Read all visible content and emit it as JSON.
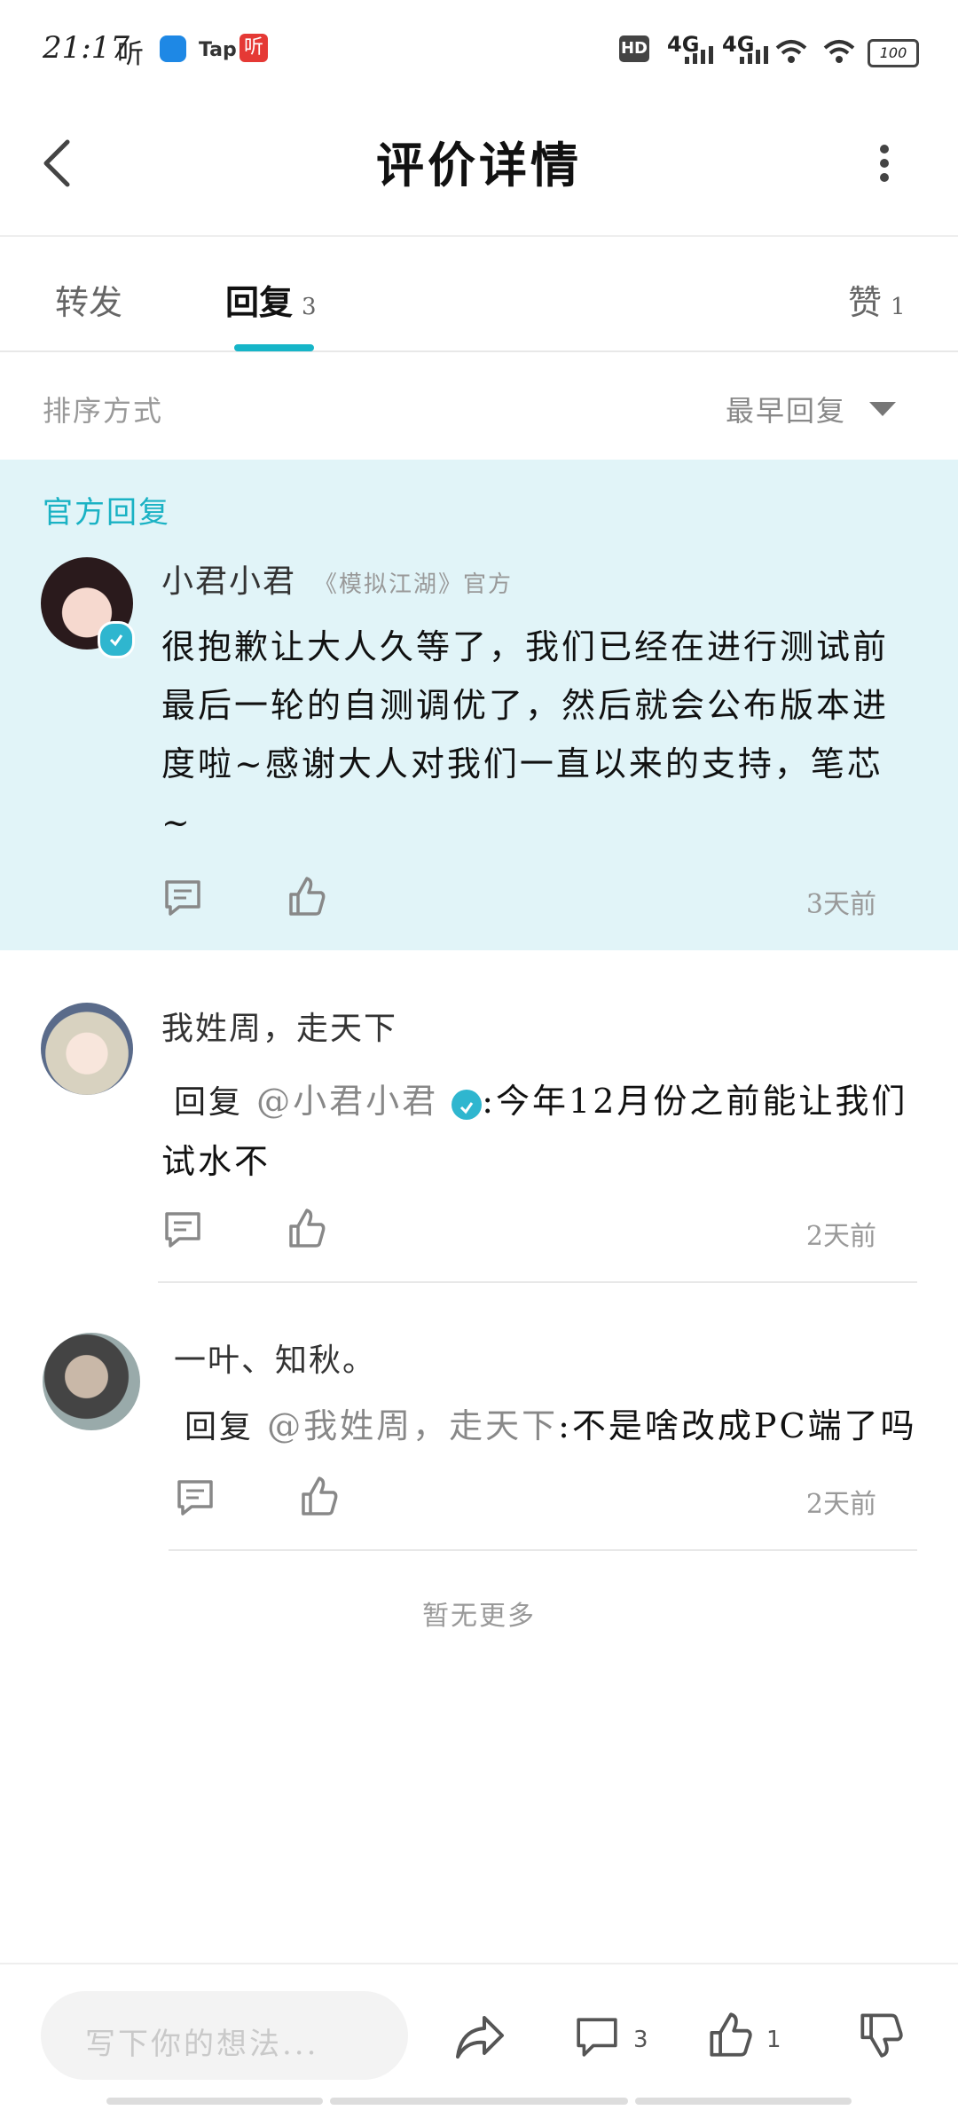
{
  "status_bar": {
    "time": "21:17",
    "app_ting": "听",
    "app_tap": "Tap",
    "app_ting2": "听",
    "hd": "HD",
    "sig1": "4G",
    "sig2": "4G",
    "battery": "100"
  },
  "header": {
    "title": "评价详情"
  },
  "tabs": {
    "forward": "转发",
    "reply": "回复",
    "reply_count": "3",
    "like": "赞",
    "like_count": "1"
  },
  "sort": {
    "label": "排序方式",
    "value": "最早回复"
  },
  "official": {
    "tag": "官方回复",
    "username": "小君小君",
    "sub": "《模拟江湖》官方",
    "content": "很抱歉让大人久等了，我们已经在进行测试前最后一轮的自测调优了，然后就会公布版本进度啦~感谢大人对我们一直以来的支持，笔芯~",
    "time": "3天前"
  },
  "replies": [
    {
      "username": "我姓周，走天下",
      "prefix": "回复",
      "mention": "@小君小君",
      "text": ":今年12月份之前能让我们试水不",
      "time": "2天前"
    },
    {
      "username": "一叶、知秋。",
      "prefix": "回复",
      "mention": "@我姓周，走天下",
      "text": ":不是啥改成PC端了吗",
      "time": "2天前"
    }
  ],
  "no_more": "暂无更多",
  "bottom": {
    "placeholder": "写下你的想法...",
    "comment_count": "3",
    "like_count": "1"
  },
  "colors": {
    "accent": "#16b5c8",
    "official_bg": "#e1f4f8"
  }
}
